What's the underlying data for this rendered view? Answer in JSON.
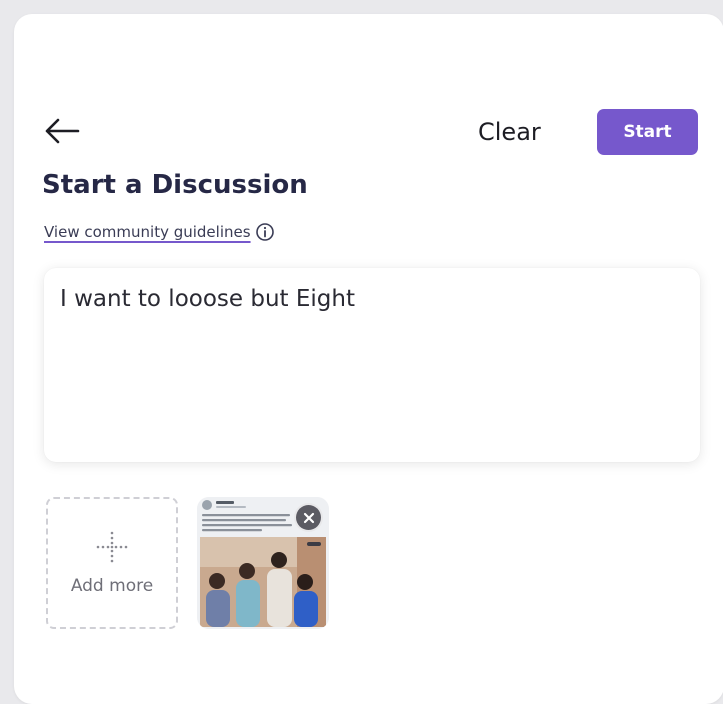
{
  "header": {
    "back_icon": "arrow-left-icon",
    "clear_label": "Clear",
    "start_label": "Start",
    "accent_color": "#7658cc"
  },
  "page": {
    "title": "Start a Discussion",
    "guidelines_link": "View community guidelines",
    "guidelines_icon": "info-icon"
  },
  "composer": {
    "text_value": "I want to looose but Eight"
  },
  "attachments": {
    "add_more_label": "Add more",
    "add_more_icon": "dotted-plus-icon",
    "items": [
      {
        "type": "image",
        "thumbnail": "screenshot-with-group-photo",
        "remove_icon": "close-circle-icon"
      }
    ]
  }
}
